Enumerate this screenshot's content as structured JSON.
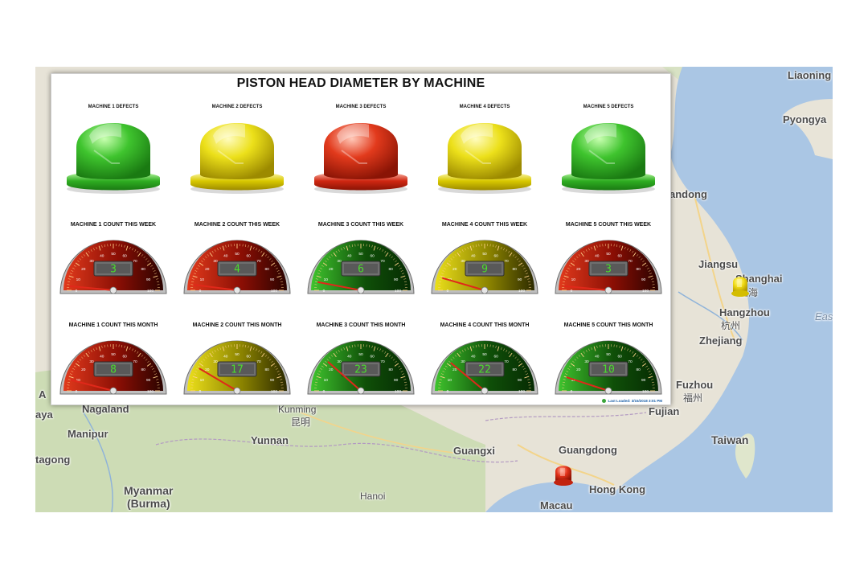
{
  "dashboard": {
    "title": "PISTON HEAD DIAMETER BY MACHINE",
    "last_loaded": "Last Loaded: 3/15/2018 3:01 PM"
  },
  "machines": [
    {
      "defects_label": "MACHINE 1 DEFECTS",
      "defects_status": "green",
      "week_label": "MACHINE 1 COUNT THIS WEEK",
      "week_value": 3,
      "week_color": "red",
      "month_label": "MACHINE 1 COUNT THIS MONTH",
      "month_value": 8,
      "month_color": "red"
    },
    {
      "defects_label": "MACHINE 2 DEFECTS",
      "defects_status": "yellow",
      "week_label": "MACHINE 2 COUNT THIS WEEK",
      "week_value": 4,
      "week_color": "red",
      "month_label": "MACHINE 2 COUNT THIS MONTH",
      "month_value": 17,
      "month_color": "yellow"
    },
    {
      "defects_label": "MACHINE 3 DEFECTS",
      "defects_status": "red",
      "week_label": "MACHINE 3 COUNT THIS WEEK",
      "week_value": 6,
      "week_color": "green",
      "month_label": "MACHINE 3 COUNT THIS MONTH",
      "month_value": 23,
      "month_color": "green"
    },
    {
      "defects_label": "MACHINE 4 DEFECTS",
      "defects_status": "yellow",
      "week_label": "MACHINE 4 COUNT THIS WEEK",
      "week_value": 9,
      "week_color": "yellow",
      "month_label": "MACHINE 4 COUNT THIS MONTH",
      "month_value": 22,
      "month_color": "green"
    },
    {
      "defects_label": "MACHINE 5 DEFECTS",
      "defects_status": "green",
      "week_label": "MACHINE 5 COUNT THIS WEEK",
      "week_value": 3,
      "week_color": "red",
      "month_label": "MACHINE 5 COUNT THIS MONTH",
      "month_value": 10,
      "month_color": "green"
    }
  ],
  "gauge_scale": {
    "min": 0,
    "max": 100,
    "ticks": [
      "0",
      "10",
      "20",
      "30",
      "40",
      "50",
      "60",
      "70",
      "80",
      "90",
      "100"
    ]
  },
  "map": {
    "labels": [
      "Liaoning",
      "Pyongya",
      "andong",
      "Jiangsu",
      "Shanghai",
      "上海",
      "Hangzhou",
      "杭州",
      "Zhejiang",
      "Eas",
      "Fuzhou",
      "福州",
      "Fujian",
      "Taiwan",
      "Guangdong",
      "Hong Kong",
      "Macau",
      "Guangxi",
      "Hanoi",
      "Yunnan",
      "Kunming",
      "昆明",
      "Nagaland",
      "Manipur",
      "Myanmar",
      "(Burma)",
      "tagong",
      "aya",
      "A"
    ],
    "pins": [
      {
        "name": "shanghai",
        "status": "yellow"
      },
      {
        "name": "hong-kong",
        "status": "red"
      }
    ]
  },
  "colors": {
    "green": "#2fb52a",
    "yellow": "#e8d400",
    "red": "#d42a14",
    "map_land": "#e9e6dc",
    "map_water": "#a8c4e2",
    "map_forest": "#c9dcb3"
  }
}
